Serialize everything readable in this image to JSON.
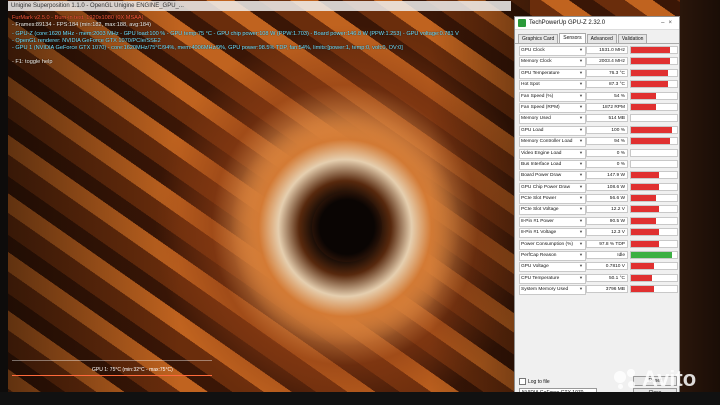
{
  "overlay": {
    "app_title": "Unigine Superposition 1.1.0 - OpenGL Unigine ENGINE_GPU_...",
    "line1": "FurMark v2.5.0 - Burn-in test, 1920x1080 (0X MSAA)",
    "line2": "- Frames:89134 - FPS:184 (min:182, max:188, avg:184)",
    "line3": "- GPU-Z (core:1620 MHz - mem:2003 MHz - GPU load:100 % - GPU temp:75 °C - GPU chip power:108 W (PPW:1.703) - Board power:146.8 W (PPW:1.253) - GPU voltage:0.781 V",
    "line4": "- OpenGL renderer: NVIDIA GeForce GTX 1070/PCIe/SSE2",
    "line5": "- GPU 1 (NVIDIA GeForce GTX 1070) - core:1620MHz/75°C/94%, mem:4006MHz/9%, GPU power:98.5% TDP, fan:54%, limits:[power:1, temp:0, volt:0, OV:0]",
    "line6": "- F1: toggle help",
    "graph_label": "GPU 1: 75°C (min:32°C - max:75°C)"
  },
  "gpuz": {
    "title": "TechPowerUp GPU-Z 2.32.0",
    "tabs": [
      "Graphics Card",
      "Sensors",
      "Advanced",
      "Validation"
    ],
    "active_tab": "Sensors",
    "sensors": [
      {
        "name": "GPU Clock",
        "value": "1531.0 MHz",
        "graph": 0.85,
        "color": "#e03030"
      },
      {
        "name": "Memory Clock",
        "value": "2003.4 MHz",
        "graph": 0.85,
        "color": "#e03030"
      },
      {
        "name": "GPU Temperature",
        "value": "76.3 °C",
        "graph": 0.8,
        "color": "#e03030"
      },
      {
        "name": "Hot Spot",
        "value": "87.3 °C",
        "graph": 0.8,
        "color": "#e03030"
      },
      {
        "name": "Fan Speed (%)",
        "value": "54 %",
        "graph": 0.55,
        "color": "#e03030"
      },
      {
        "name": "Fan Speed (RPM)",
        "value": "1872 RPM",
        "graph": 0.55,
        "color": "#e03030"
      },
      {
        "name": "Memory Used",
        "value": "514 MB",
        "graph": 0.0,
        "color": "#e03030"
      },
      {
        "name": "GPU Load",
        "value": "100 %",
        "graph": 0.9,
        "color": "#e03030"
      },
      {
        "name": "Memory Controller Load",
        "value": "94 %",
        "graph": 0.85,
        "color": "#e03030"
      },
      {
        "name": "Video Engine Load",
        "value": "0 %",
        "graph": 0.0,
        "color": "#e03030"
      },
      {
        "name": "Bus Interface Load",
        "value": "0 %",
        "graph": 0.0,
        "color": "#e03030"
      },
      {
        "name": "Board Power Draw",
        "value": "147.9 W",
        "graph": 0.6,
        "color": "#e03030"
      },
      {
        "name": "GPU Chip Power Draw",
        "value": "108.6 W",
        "graph": 0.6,
        "color": "#e03030"
      },
      {
        "name": "PCIe Slot Power",
        "value": "56.6 W",
        "graph": 0.55,
        "color": "#e03030"
      },
      {
        "name": "PCIe Slot Voltage",
        "value": "12.2 V",
        "graph": 0.6,
        "color": "#e03030"
      },
      {
        "name": "8-Pin #1 Power",
        "value": "90.5 W",
        "graph": 0.55,
        "color": "#e03030"
      },
      {
        "name": "8-Pin #1 Voltage",
        "value": "12.3 V",
        "graph": 0.6,
        "color": "#e03030"
      },
      {
        "name": "Power Consumption (%)",
        "value": "97.8 % TDP",
        "graph": 0.6,
        "color": "#e03030"
      },
      {
        "name": "PerfCap Reason",
        "value": "Idle",
        "graph": 0.9,
        "color": "#3cb043"
      },
      {
        "name": "GPU Voltage",
        "value": "0.7810 V",
        "graph": 0.5,
        "color": "#e03030"
      },
      {
        "name": "CPU Temperature",
        "value": "50.1 °C",
        "graph": 0.45,
        "color": "#e03030"
      },
      {
        "name": "System Memory Used",
        "value": "3796 MB",
        "graph": 0.5,
        "color": "#e03030"
      }
    ],
    "log_to_file": "Log to file",
    "reset": "Reset",
    "gpu_select": "NVIDIA GeForce GTX 1070",
    "close": "Close"
  },
  "watermark": "Avito"
}
